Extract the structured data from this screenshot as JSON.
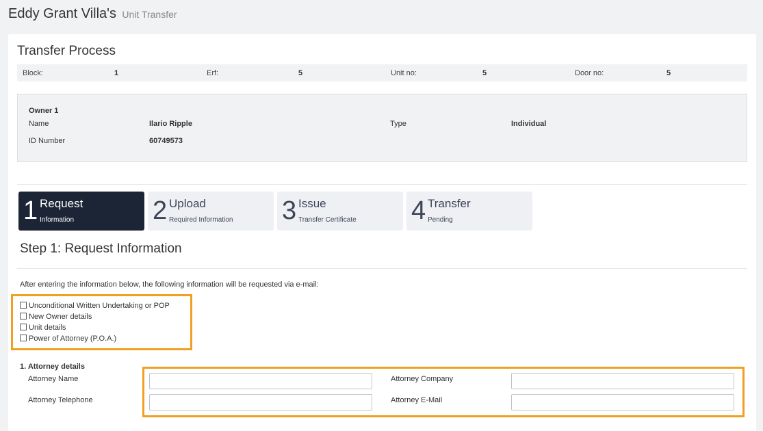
{
  "header": {
    "title": "Eddy Grant Villa's",
    "subtitle": "Unit Transfer"
  },
  "card": {
    "title": "Transfer Process"
  },
  "info": [
    {
      "label": "Block:",
      "value": "1"
    },
    {
      "label": "Erf:",
      "value": "5"
    },
    {
      "label": "Unit no:",
      "value": "5"
    },
    {
      "label": "Door no:",
      "value": "5"
    }
  ],
  "owner": {
    "heading": "Owner 1",
    "name_label": "Name",
    "name_value": "Ilario Ripple",
    "type_label": "Type",
    "type_value": "Individual",
    "id_label": "ID Number",
    "id_value": "60749573"
  },
  "steps": [
    {
      "num": "1",
      "name": "Request",
      "sub": "Information",
      "active": true
    },
    {
      "num": "2",
      "name": "Upload",
      "sub": "Required Information",
      "active": false
    },
    {
      "num": "3",
      "name": "Issue",
      "sub": "Transfer Certificate",
      "active": false
    },
    {
      "num": "4",
      "name": "Transfer",
      "sub": "Pending",
      "active": false
    }
  ],
  "step_heading": "Step 1: Request Information",
  "intro": "After entering the information below, the following information will be requested via e-mail:",
  "checklist": [
    {
      "label": "Unconditional Written Undertaking or POP",
      "checked": false
    },
    {
      "label": "New Owner details",
      "checked": false
    },
    {
      "label": "Unit details",
      "checked": false
    },
    {
      "label": "Power of Attorney (P.O.A.)",
      "checked": false
    }
  ],
  "attorney": {
    "title": "1. Attorney details",
    "name_label": "Attorney Name",
    "name_value": "",
    "company_label": "Attorney Company",
    "company_value": "",
    "phone_label": "Attorney Telephone",
    "phone_value": "",
    "email_label": "Attorney E-Mail",
    "email_value": ""
  },
  "colors": {
    "active_step": "#1c2536",
    "inactive_step": "#eef0f4",
    "highlight": "#f0a020",
    "panel_bg": "#f1f2f4"
  }
}
